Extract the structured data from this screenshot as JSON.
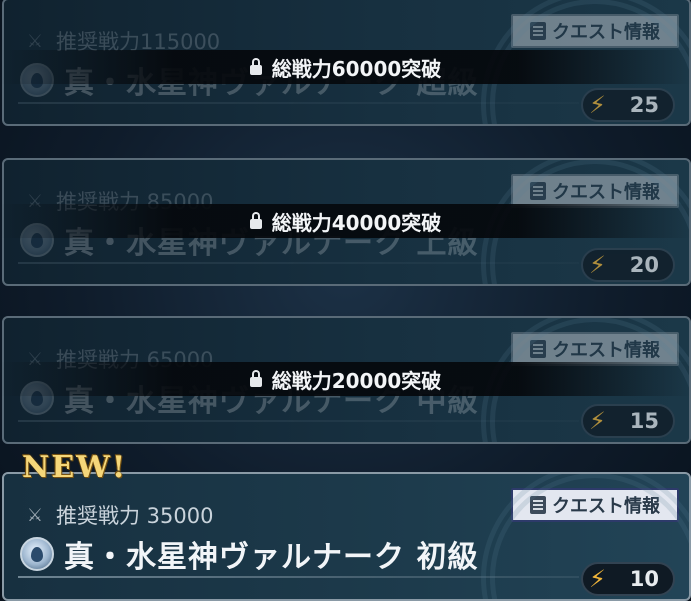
{
  "quests": [
    {
      "recommended_label": "推奨戦力115000",
      "name": "真・水星神ヴァルナーク 超級",
      "info_button": "クエスト情報",
      "stamina_cost": "25",
      "lock_text": "総戦力60000突破"
    },
    {
      "recommended_label": "推奨戦力 85000",
      "name": "真・水星神ヴァルナーク 上級",
      "info_button": "クエスト情報",
      "stamina_cost": "20",
      "lock_text": "総戦力40000突破"
    },
    {
      "recommended_label": "推奨戦力 65000",
      "name": "真・水星神ヴァルナーク 中級",
      "info_button": "クエスト情報",
      "stamina_cost": "15",
      "lock_text": "総戦力20000突破"
    },
    {
      "badge": "NEW!",
      "recommended_label": "推奨戦力 35000",
      "name": "真・水星神ヴァルナーク 初級",
      "info_button": "クエスト情報",
      "stamina_cost": "10"
    }
  ],
  "icons": {
    "element": "water-drop-icon",
    "recommended": "crossed-swords-icon",
    "info": "document-icon",
    "stamina": "lightning-bolt-icon",
    "lock": "padlock-icon"
  },
  "colors": {
    "stamina_bolt": "#f0b53a",
    "new_badge": "#f5d77a"
  }
}
